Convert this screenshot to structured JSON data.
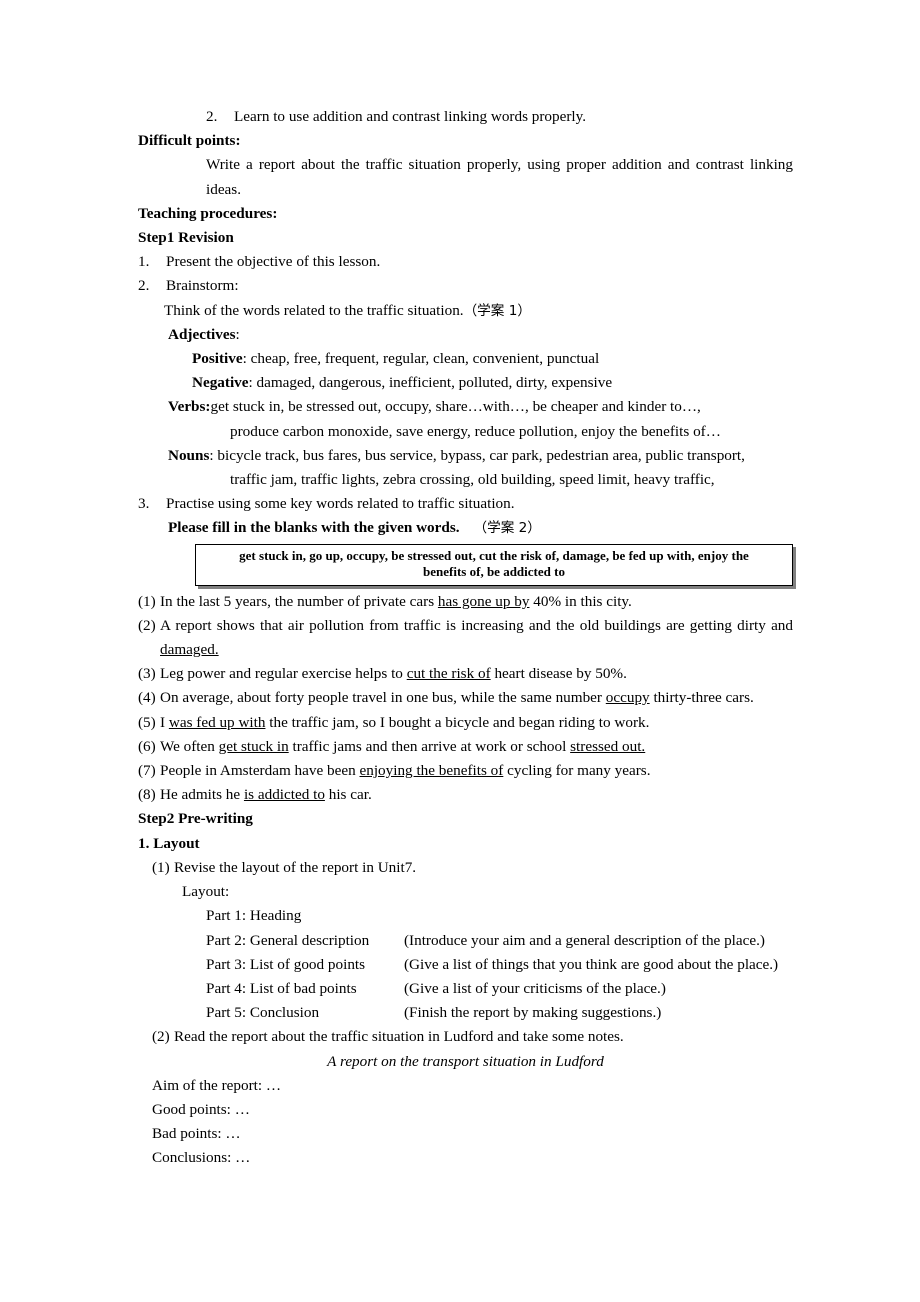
{
  "document": {
    "objective_item_2": {
      "number": "2.",
      "text": "Learn to use addition and contrast linking words properly."
    },
    "difficult_points": {
      "heading": "Difficult points:",
      "body": "Write a report about the traffic situation properly, using proper addition and contrast linking ideas."
    },
    "teaching_procedures_heading": "Teaching procedures:",
    "step1": {
      "heading": "Step1 Revision",
      "item1": {
        "number": "1.",
        "text": "Present the objective of this lesson."
      },
      "item2": {
        "number": "2.",
        "text": "Brainstorm:",
        "sub_line": "Think of the words related to the traffic situation.",
        "sub_line_cjk": "（学案 1）",
        "adjectives_label": "Adjectives",
        "adjectives_colon": ":",
        "positive_label": "Positive",
        "positive_value": ": cheap, free, frequent, regular, clean, convenient, punctual",
        "negative_label": "Negative",
        "negative_value": ": damaged, dangerous, inefficient, polluted, dirty, expensive",
        "verbs_label": "Verbs:",
        "verbs_value_line1": "get stuck in, be stressed out, occupy, share…with…, be cheaper and kinder to…,",
        "verbs_value_line2": "produce carbon monoxide, save energy, reduce pollution, enjoy the benefits of…",
        "nouns_label": "Nouns",
        "nouns_value_line1": ": bicycle track, bus fares, bus service, bypass, car park, pedestrian area, public transport,",
        "nouns_value_line2": "traffic jam, traffic lights, zebra crossing, old building, speed limit, heavy traffic,"
      },
      "item3": {
        "number": "3.",
        "text": "Practise using some key words related to traffic situation.",
        "instruction": "Please fill in the blanks with the given words.",
        "instruction_cjk": "（学案 2）"
      },
      "word_bank": {
        "line1": "get stuck in, go up, occupy, be stressed out, cut the risk of, damage, be fed up with,    enjoy the",
        "line2": "benefits of, be addicted to"
      },
      "exercises": [
        {
          "number": "(1)",
          "pre": "In the last 5 years, the number of private cars ",
          "blank": "has gone up by",
          "post": " 40% in this city."
        },
        {
          "number": "(2)",
          "pre": "A report shows that air pollution from traffic is increasing and the old buildings are getting dirty and ",
          "blank": "damaged.",
          "post": ""
        },
        {
          "number": "(3)",
          "pre": "Leg power and regular exercise helps to ",
          "blank": "cut the risk of",
          "post": " heart disease by 50%."
        },
        {
          "number": "(4)",
          "pre": "On average, about forty people travel in one bus, while the same number ",
          "blank": "occupy",
          "post": " thirty-three cars."
        },
        {
          "number": "(5)",
          "pre": "I ",
          "blank": "was fed up with",
          "post": " the traffic jam, so I bought a bicycle and began riding to work."
        },
        {
          "number": "(6)",
          "pre": "We often ",
          "blank": "get stuck in",
          "post": " traffic jams and then arrive at work or school ",
          "blank2": "stressed out."
        },
        {
          "number": "(7)",
          "pre": "People in Amsterdam have been ",
          "blank": "enjoying the benefits of",
          "post": " cycling for many years."
        },
        {
          "number": "(8)",
          "pre": "He admits he ",
          "blank": "is addicted to",
          "post": " his car."
        }
      ]
    },
    "step2": {
      "heading": "Step2 Pre-writing",
      "section1_heading": "1. Layout",
      "item1": {
        "number": "(1)",
        "text": "Revise the layout of the report in Unit7."
      },
      "layout_label": "Layout:",
      "parts": [
        {
          "name": "Part 1: Heading",
          "desc": ""
        },
        {
          "name": "Part 2: General description",
          "desc": "(Introduce your aim and a general description of the place.)"
        },
        {
          "name": "Part 3: List of good points",
          "desc": "(Give a list of things that you think are good about the place.)"
        },
        {
          "name": "Part 4: List of bad points",
          "desc": "(Give a list of your criticisms of the place.)"
        },
        {
          "name": "Part 5: Conclusion",
          "desc": "(Finish the report by making suggestions.)"
        }
      ],
      "item2": {
        "number": "(2)",
        "text": "Read the report about the traffic situation in Ludford and take some notes."
      },
      "report_title": "A report on the transport situation in Ludford",
      "notes": [
        "Aim of the report: …",
        "Good points: …",
        "Bad points: …",
        "Conclusions: …"
      ]
    }
  }
}
